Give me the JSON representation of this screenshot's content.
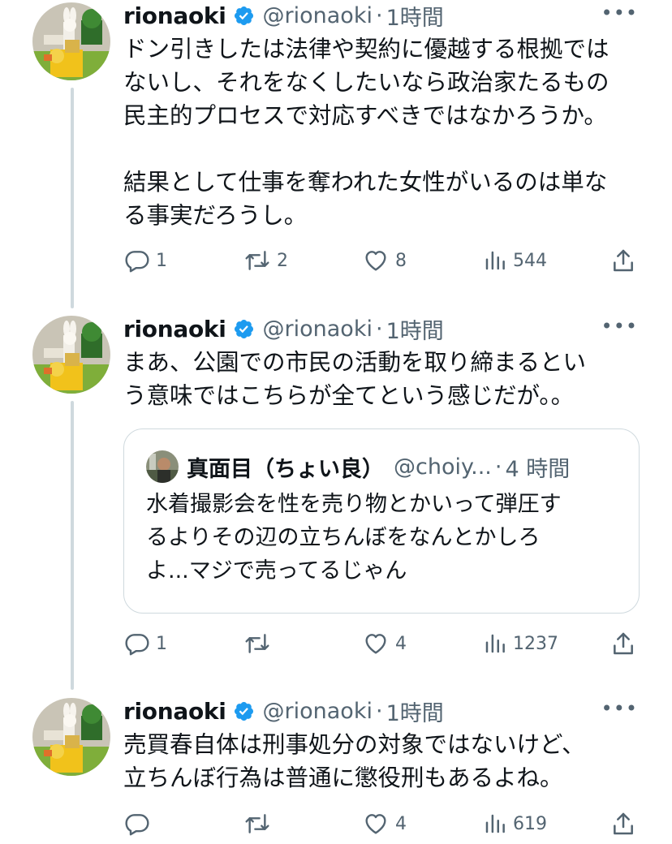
{
  "colors": {
    "verified_blue": "#1d9bf0",
    "muted": "#536471",
    "thread_line": "#cfd9de"
  },
  "tweets": [
    {
      "name": "rionaoki",
      "handle": "@rionaoki",
      "time_sep": "·",
      "time": "1時間",
      "text": "ドン引きしたは法律や契約に優越する根拠では\nないし、それをなくしたいなら政治家たるもの\n民主的プロセスで対応すべきではなかろうか。\n\n結果として仕事を奪われた女性がいるのは単な\nる事実だろうし。",
      "replies": "1",
      "retweets": "2",
      "likes": "8",
      "views": "544"
    },
    {
      "name": "rionaoki",
      "handle": "@rionaoki",
      "time_sep": "·",
      "time": "1時間",
      "text": "まあ、公園での市民の活動を取り締まるとい\nう意味ではこちらが全てという感じだが。。",
      "replies": "1",
      "retweets": "",
      "likes": "4",
      "views": "1237",
      "quote": {
        "name": "真面目（ちょい良）",
        "handle": "@choiy...",
        "time_sep": "·",
        "time": "4 時間",
        "text": "水着撮影会を性を売り物とかいって弾圧す\nるよりその辺の立ちんぼをなんとかしろ\nよ...マジで売ってるじゃん"
      }
    },
    {
      "name": "rionaoki",
      "handle": "@rionaoki",
      "time_sep": "·",
      "time": "1時間",
      "text": "売買春自体は刑事処分の対象ではないけど、\n立ちんぼ行為は普通に懲役刑もあるよね。",
      "replies": "",
      "retweets": "",
      "likes": "4",
      "views": "619"
    }
  ]
}
